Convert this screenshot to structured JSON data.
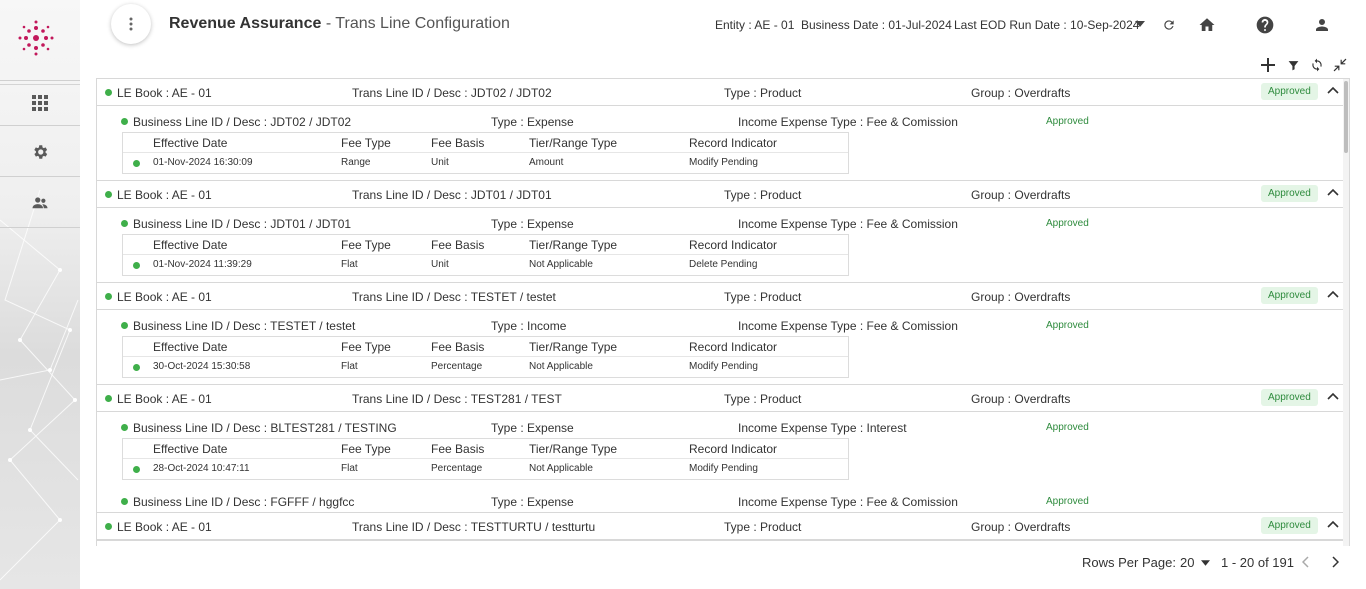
{
  "header": {
    "title_main": "Revenue Assurance",
    "title_sub": " - Trans Line Configuration",
    "entity": "Entity : AE - 01",
    "business_date": "Business Date : 01-Jul-2024",
    "last_eod": "Last EOD Run Date : 10-Sep-2024"
  },
  "sidebar": {
    "items": [
      {
        "icon": "apps-grid-icon"
      },
      {
        "icon": "gear-icon"
      },
      {
        "icon": "users-icon"
      }
    ]
  },
  "groups": [
    {
      "le_book": "LE Book : AE - 01",
      "trans_line": "Trans Line ID / Desc : JDT02 / JDT02",
      "type": "Type : Product",
      "group": "Group : Overdrafts",
      "status": "Approved",
      "business_lines": [
        {
          "bl": "Business Line ID / Desc : JDT02 / JDT02",
          "type": "Type : Expense",
          "income_expense": "Income Expense Type : Fee & Comission",
          "status": "Approved",
          "table": {
            "headers": [
              "Effective Date",
              "Fee Type",
              "Fee Basis",
              "Tier/Range Type",
              "Record Indicator"
            ],
            "row": [
              "01-Nov-2024 16:30:09",
              "Range",
              "Unit",
              "Amount",
              "Modify Pending"
            ]
          }
        }
      ]
    },
    {
      "le_book": "LE Book : AE - 01",
      "trans_line": "Trans Line ID / Desc : JDT01 / JDT01",
      "type": "Type : Product",
      "group": "Group : Overdrafts",
      "status": "Approved",
      "business_lines": [
        {
          "bl": "Business Line ID / Desc : JDT01 / JDT01",
          "type": "Type : Expense",
          "income_expense": "Income Expense Type : Fee & Comission",
          "status": "Approved",
          "table": {
            "headers": [
              "Effective Date",
              "Fee Type",
              "Fee Basis",
              "Tier/Range Type",
              "Record Indicator"
            ],
            "row": [
              "01-Nov-2024 11:39:29",
              "Flat",
              "Unit",
              "Not Applicable",
              "Delete Pending"
            ]
          }
        }
      ]
    },
    {
      "le_book": "LE Book : AE - 01",
      "trans_line": "Trans Line ID / Desc : TESTET / testet",
      "type": "Type : Product",
      "group": "Group : Overdrafts",
      "status": "Approved",
      "business_lines": [
        {
          "bl": "Business Line ID / Desc : TESTET / testet",
          "type": "Type : Income",
          "income_expense": "Income Expense Type : Fee & Comission",
          "status": "Approved",
          "table": {
            "headers": [
              "Effective Date",
              "Fee Type",
              "Fee Basis",
              "Tier/Range Type",
              "Record Indicator"
            ],
            "row": [
              "30-Oct-2024 15:30:58",
              "Flat",
              "Percentage",
              "Not Applicable",
              "Modify Pending"
            ]
          }
        }
      ]
    },
    {
      "le_book": "LE Book : AE - 01",
      "trans_line": "Trans Line ID / Desc : TEST281 / TEST",
      "type": "Type : Product",
      "group": "Group : Overdrafts",
      "status": "Approved",
      "business_lines": [
        {
          "bl": "Business Line ID / Desc : BLTEST281 / TESTING",
          "type": "Type : Expense",
          "income_expense": "Income Expense Type : Interest",
          "status": "Approved",
          "table": {
            "headers": [
              "Effective Date",
              "Fee Type",
              "Fee Basis",
              "Tier/Range Type",
              "Record Indicator"
            ],
            "row": [
              "28-Oct-2024 10:47:11",
              "Flat",
              "Percentage",
              "Not Applicable",
              "Modify Pending"
            ]
          }
        },
        {
          "bl": "Business Line ID / Desc : FGFFF / hggfcc",
          "type": "Type : Expense",
          "income_expense": "Income Expense Type : Fee & Comission",
          "status": "Approved"
        }
      ]
    },
    {
      "le_book": "LE Book : AE - 01",
      "trans_line": "Trans Line ID / Desc : TESTTURTU / testturtu",
      "type": "Type : Product",
      "group": "Group : Overdrafts",
      "status": "Approved",
      "business_lines": []
    }
  ],
  "footer": {
    "rows_per_page_label": "Rows Per Page:",
    "rows_per_page_value": "20",
    "range": "1 - 20 of 191"
  }
}
